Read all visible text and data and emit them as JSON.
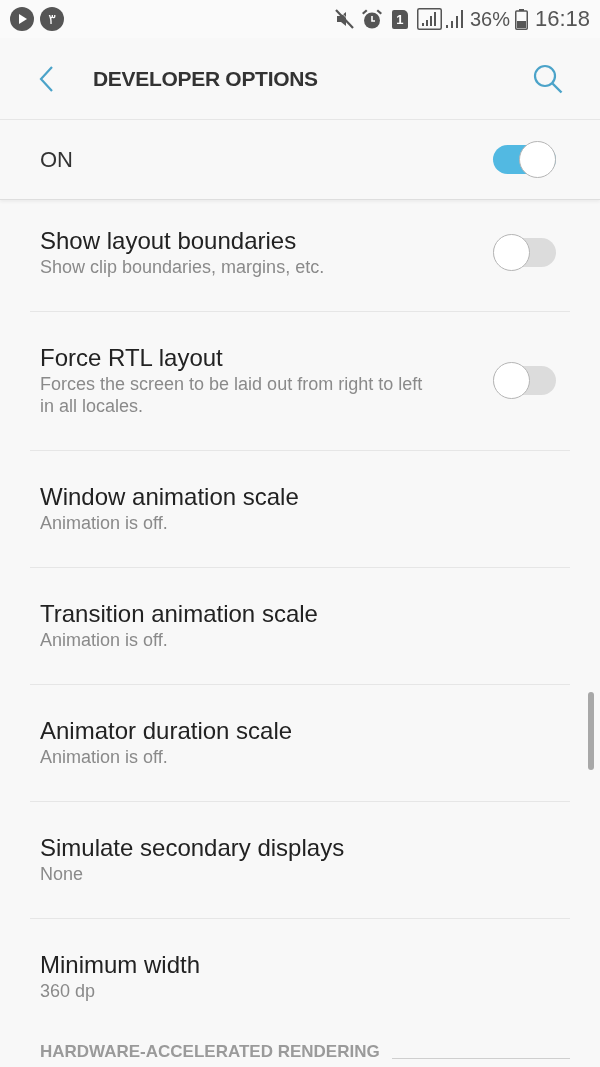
{
  "status_bar": {
    "notification_badge": "۳",
    "sim_slot": "1",
    "battery": "36%",
    "time": "16:18"
  },
  "header": {
    "title": "DEVELOPER OPTIONS"
  },
  "master_switch": {
    "label": "ON",
    "on": true
  },
  "settings": [
    {
      "kind": "toggle",
      "title": "Show layout boundaries",
      "summary": "Show clip boundaries, margins, etc.",
      "on": false
    },
    {
      "kind": "toggle",
      "title": "Force RTL layout",
      "summary": "Forces the screen to be laid out from right to left in all locales.",
      "on": false
    },
    {
      "kind": "value",
      "title": "Window animation scale",
      "summary": "Animation is off."
    },
    {
      "kind": "value",
      "title": "Transition animation scale",
      "summary": "Animation is off."
    },
    {
      "kind": "value",
      "title": "Animator duration scale",
      "summary": "Animation is off."
    },
    {
      "kind": "value",
      "title": "Simulate secondary displays",
      "summary": "None"
    },
    {
      "kind": "value",
      "title": "Minimum width",
      "summary": "360 dp"
    }
  ],
  "section_header": {
    "title": "HARDWARE-ACCELERATED RENDERING"
  }
}
